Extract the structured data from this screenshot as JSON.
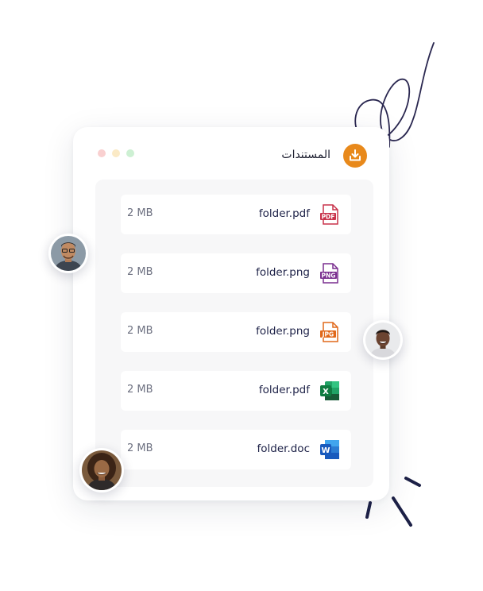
{
  "header": {
    "title": "المستندات",
    "icon": "download-icon",
    "accent_color": "#e8891b"
  },
  "window_dots": [
    "#f9d0d0",
    "#fbeac6",
    "#cdf0d3"
  ],
  "files": [
    {
      "name": "folder.pdf",
      "size": "2 MB",
      "icon": "pdf-file-icon",
      "icon_label": "PDF",
      "color": "#c8324a"
    },
    {
      "name": "folder.png",
      "size": "2 MB",
      "icon": "png-file-icon",
      "icon_label": "PNG",
      "color": "#7a2f8f"
    },
    {
      "name": "folder.png",
      "size": "2 MB",
      "icon": "jpg-file-icon",
      "icon_label": "JPG",
      "color": "#e0681a"
    },
    {
      "name": "folder.pdf",
      "size": "2 MB",
      "icon": "excel-icon",
      "icon_label": "X",
      "color": "#1e7a45"
    },
    {
      "name": "folder.doc",
      "size": "2 MB",
      "icon": "word-icon",
      "icon_label": "W",
      "color": "#2358b8"
    }
  ]
}
